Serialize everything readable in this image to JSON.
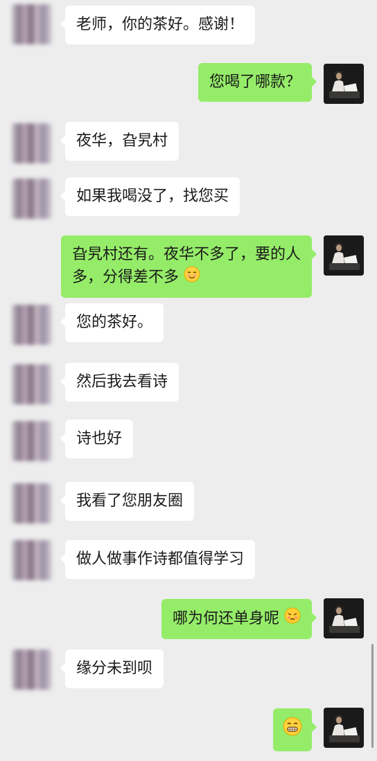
{
  "messages": [
    {
      "side": "left",
      "text": "老师，你的茶好。感谢！"
    },
    {
      "side": "right",
      "text": "您喝了哪款？"
    },
    {
      "side": "left",
      "text": "夜华，旮旯村"
    },
    {
      "side": "left",
      "text": "如果我喝没了，找您买"
    },
    {
      "side": "right",
      "text": "旮旯村还有。夜华不多了，要的人多，分得差不多",
      "emoji": "smile-emoji"
    },
    {
      "side": "left",
      "text": "您的茶好。"
    },
    {
      "side": "left",
      "text": "然后我去看诗"
    },
    {
      "side": "left",
      "text": "诗也好"
    },
    {
      "side": "left",
      "text": "我看了您朋友圈"
    },
    {
      "side": "left",
      "text": "做人做事作诗都值得学习"
    },
    {
      "side": "right",
      "text": "哪为何还单身呢",
      "emoji": "pouting-emoji"
    },
    {
      "side": "left",
      "text": "缘分未到呗"
    },
    {
      "side": "right",
      "text": "",
      "emoji": "grin-emoji"
    }
  ],
  "colors": {
    "background": "#ededed",
    "left_bubble": "#ffffff",
    "right_bubble": "#95ec69",
    "text": "#1a1a1a"
  }
}
